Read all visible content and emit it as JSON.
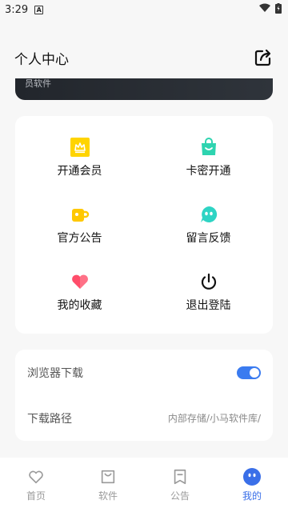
{
  "status_bar": {
    "time": "3:29",
    "notification_letter": "A"
  },
  "header": {
    "title": "个人中心",
    "share_icon": "share-icon"
  },
  "banner": {
    "text": "员软件"
  },
  "grid": {
    "items": [
      {
        "label": "开通会员",
        "icon": "vip-crown-icon",
        "color": "#FFD400"
      },
      {
        "label": "卡密开通",
        "icon": "bag-icon",
        "color": "#2ED4B0"
      },
      {
        "label": "官方公告",
        "icon": "mug-icon",
        "color": "#FFC800"
      },
      {
        "label": "留言反馈",
        "icon": "chat-face-icon",
        "color": "#2ED4C4"
      },
      {
        "label": "我的收藏",
        "icon": "heart-icon",
        "color": "#FF4D6A"
      },
      {
        "label": "退出登陆",
        "icon": "power-icon",
        "color": "#111111"
      }
    ]
  },
  "settings": {
    "browser_download": {
      "label": "浏览器下载",
      "enabled": true
    },
    "download_path": {
      "label": "下载路径",
      "value": "内部存储/小马软件库/"
    }
  },
  "tabbar": {
    "tabs": [
      {
        "label": "首页",
        "icon": "heart-outline-icon",
        "active": false
      },
      {
        "label": "软件",
        "icon": "shopping-bag-icon",
        "active": false
      },
      {
        "label": "公告",
        "icon": "bookmark-icon",
        "active": false
      },
      {
        "label": "我的",
        "icon": "profile-face-icon",
        "active": true
      }
    ]
  },
  "colors": {
    "accent": "#3A6FE8",
    "toggle_on": "#3A7BF0"
  }
}
